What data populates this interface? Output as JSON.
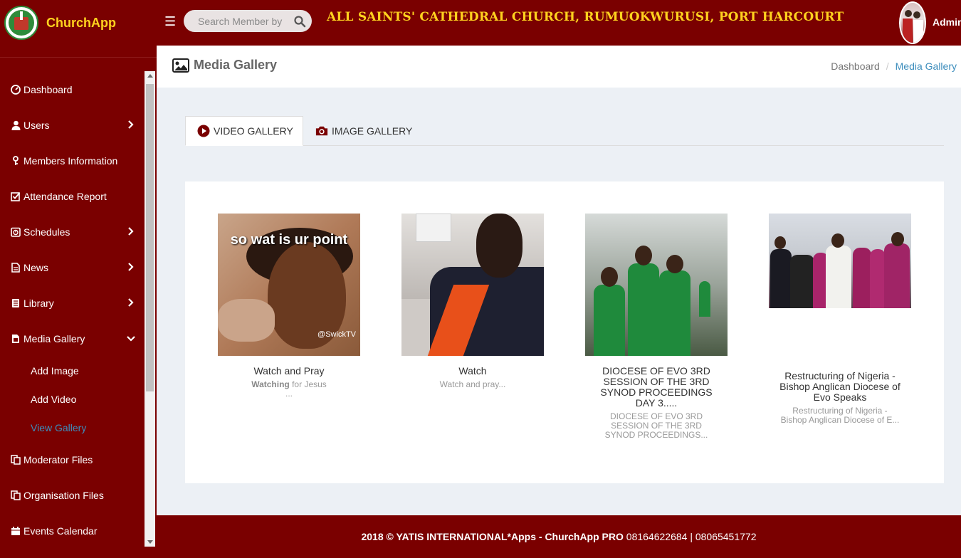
{
  "app": {
    "name": "ChurchApp",
    "church_title": "ALL SAINTS' CATHEDRAL CHURCH, RUMUOKWURUSI, PORT HARCOURT",
    "admin_label": "Admin"
  },
  "search": {
    "placeholder": "Search Member by"
  },
  "sidebar": {
    "items": [
      {
        "label": "Dashboard",
        "icon": "dashboard-icon",
        "has_arrow": false
      },
      {
        "label": "Users",
        "icon": "user-icon",
        "has_arrow": true
      },
      {
        "label": "Members Information",
        "icon": "key-icon",
        "has_arrow": false
      },
      {
        "label": "Attendance Report",
        "icon": "check-square-icon",
        "has_arrow": false
      },
      {
        "label": "Schedules",
        "icon": "clock-icon",
        "has_arrow": true
      },
      {
        "label": "News",
        "icon": "document-icon",
        "has_arrow": true
      },
      {
        "label": "Library",
        "icon": "book-icon",
        "has_arrow": true
      },
      {
        "label": "Media Gallery",
        "icon": "media-file-icon",
        "has_arrow": true,
        "expanded": true
      },
      {
        "label": "Moderator Files",
        "icon": "files-icon",
        "has_arrow": false
      },
      {
        "label": "Organisation Files",
        "icon": "files-icon",
        "has_arrow": false
      },
      {
        "label": "Events Calendar",
        "icon": "calendar-icon",
        "has_arrow": false
      }
    ],
    "sub_items": [
      {
        "label": "Add Image",
        "active": false
      },
      {
        "label": "Add Video",
        "active": false
      },
      {
        "label": "View Gallery",
        "active": true
      }
    ]
  },
  "page": {
    "title": "Media Gallery",
    "breadcrumb": {
      "home": "Dashboard",
      "current": "Media Gallery"
    }
  },
  "tabs": [
    {
      "label": "VIDEO GALLERY",
      "icon": "play-circle-icon",
      "active": true
    },
    {
      "label": "IMAGE GALLERY",
      "icon": "camera-icon",
      "active": false
    }
  ],
  "gallery": {
    "items": [
      {
        "title": "Watch and Pray",
        "desc_bold": "Watching",
        "desc_rest": " for Jesus",
        "desc_more": "...",
        "thumb_caption": "so wat is ur point",
        "thumb_watermark": "@SwickTV"
      },
      {
        "title": "Watch",
        "desc": "Watch and pray..."
      },
      {
        "title": "DIOCESE OF EVO 3RD SESSION OF THE 3RD SYNOD PROCEEDINGS DAY 3.....",
        "desc": "DIOCESE OF EVO 3RD SESSION OF THE 3RD SYNOD PROCEEDINGS..."
      },
      {
        "title": "Restructuring of Nigeria - Bishop Anglican Diocese of Evo Speaks",
        "desc": "Restructuring of Nigeria - Bishop Anglican Diocese of E..."
      }
    ]
  },
  "footer": {
    "bold_text": "2018 © YATIS INTERNATIONAL*Apps - ChurchApp PRO",
    "phones": " 08164622684 | 08065451772"
  },
  "colors": {
    "primary": "#7a0000",
    "accent_yellow": "#ffd21e",
    "link_blue": "#3c8dbc"
  }
}
